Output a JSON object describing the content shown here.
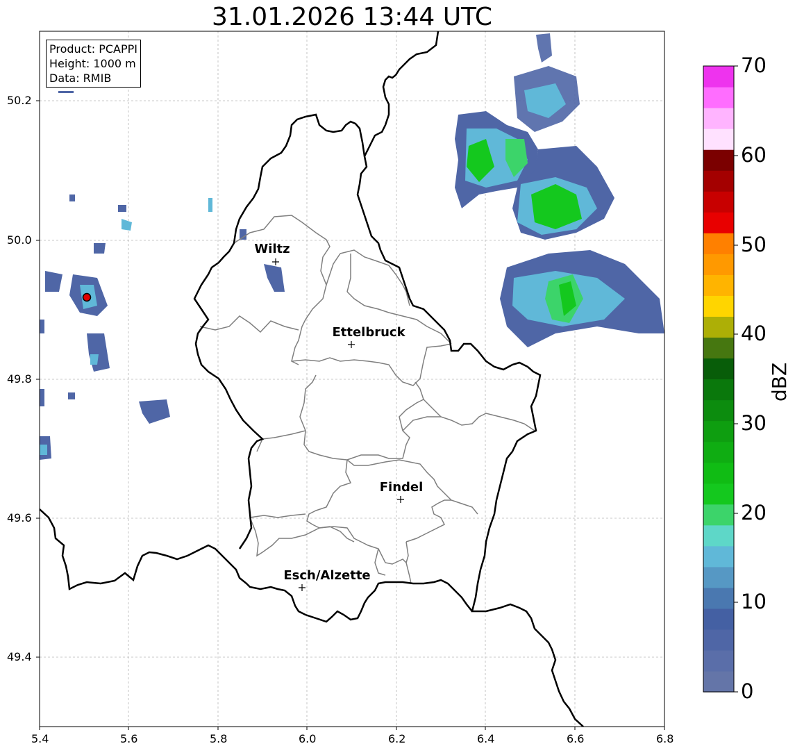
{
  "title": "31.01.2026 13:44 UTC",
  "info": {
    "product": "Product: PCAPPI",
    "height": "Height: 1000 m",
    "data": "Data: RMIB"
  },
  "axes": {
    "x_ticks": [
      "5.4",
      "5.6",
      "5.8",
      "6.0",
      "6.2",
      "6.4",
      "6.6",
      "6.8"
    ],
    "y_ticks": [
      "50.2",
      "50.0",
      "49.8",
      "49.6",
      "49.4"
    ]
  },
  "cities": [
    {
      "name": "Wiltz"
    },
    {
      "name": "Ettelbruck"
    },
    {
      "name": "Findel"
    },
    {
      "name": "Esch/Alzette"
    }
  ],
  "colorbar": {
    "unit": "dBZ",
    "ticks": [
      "0",
      "10",
      "20",
      "30",
      "40",
      "50",
      "60",
      "70"
    ],
    "colors": [
      "#6475a8",
      "#5a6ea9",
      "#4f66a6",
      "#4460a3",
      "#4a78b0",
      "#5698c4",
      "#60b8d8",
      "#5ed7c8",
      "#3cd46a",
      "#14c81e",
      "#10bc14",
      "#0fad12",
      "#0e9e10",
      "#0c8c0e",
      "#0a780c",
      "#085d09",
      "#467710",
      "#adaf06",
      "#ffd500",
      "#ffb400",
      "#ff9900",
      "#ff8000",
      "#e80000",
      "#c80000",
      "#a40000",
      "#7b0000",
      "#ffe1ff",
      "#ffb4ff",
      "#ff6dff",
      "#ee33ee"
    ]
  },
  "colors": {
    "border": "#000000",
    "commune_lines": "#7f7f7f",
    "grid": "#b8b8b8",
    "radar_marker": "#e00000"
  },
  "map_data": {
    "extent": {
      "lon": [
        5.4,
        6.8
      ],
      "lat": [
        49.3,
        50.3
      ]
    },
    "radar_site": {
      "lon": 5.505,
      "lat": 49.915
    },
    "city_points": [
      {
        "name": "Wiltz",
        "lon": 5.935,
        "lat": 49.968
      },
      {
        "name": "Ettelbruck",
        "lon": 6.103,
        "lat": 49.849
      },
      {
        "name": "Findel",
        "lon": 6.21,
        "lat": 49.627
      },
      {
        "name": "Esch/Alzette",
        "lon": 5.987,
        "lat": 49.5
      }
    ]
  }
}
